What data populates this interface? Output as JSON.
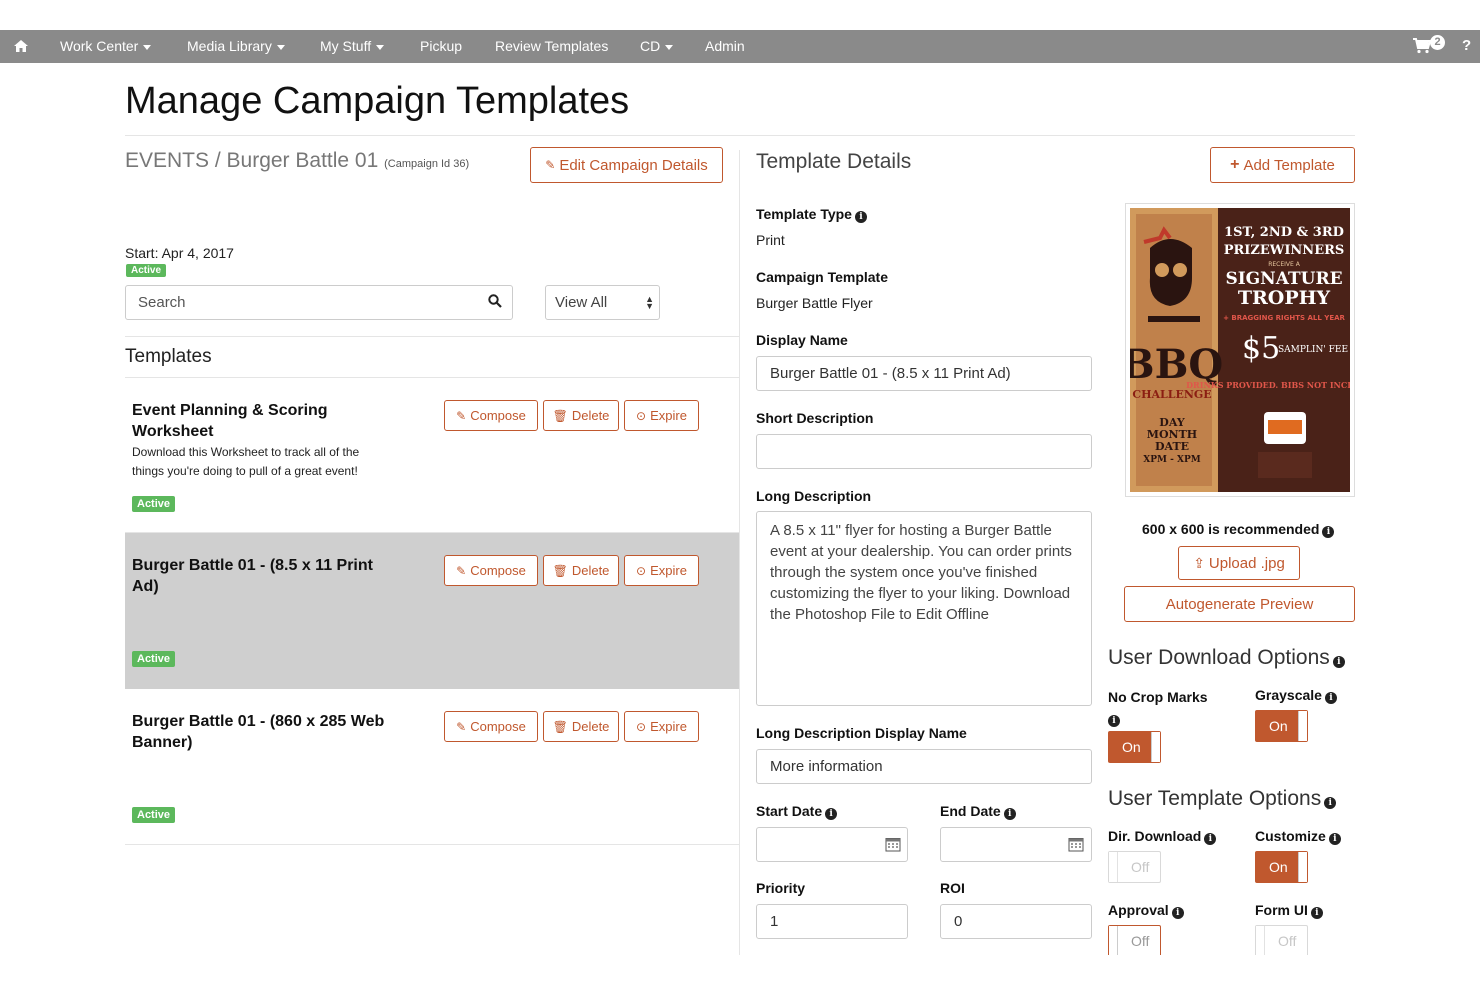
{
  "nav": {
    "items": [
      {
        "label": "Work Center"
      },
      {
        "label": "Media Library"
      },
      {
        "label": "My Stuff"
      },
      {
        "label": "Pickup"
      },
      {
        "label": "Review Templates"
      },
      {
        "label": "CD"
      },
      {
        "label": "Admin"
      }
    ],
    "cart_count": "2",
    "help": "?"
  },
  "page": {
    "title": "Manage Campaign Templates"
  },
  "campaign": {
    "breadcrumb": "EVENTS / Burger Battle 01",
    "id_note": "(Campaign Id 36)",
    "edit_label": "Edit Campaign Details",
    "start": "Start: Apr 4, 2017",
    "status": "Active"
  },
  "search": {
    "placeholder": "Search"
  },
  "filter": {
    "selected": "View All"
  },
  "templates": {
    "heading": "Templates",
    "compose_label": "Compose",
    "delete_label": "Delete",
    "expire_label": "Expire",
    "items": [
      {
        "title": "Event Planning & Scoring Worksheet",
        "desc": "Download this Worksheet to track all of the things you're doing to pull of a great event!",
        "status": "Active"
      },
      {
        "title": "Burger Battle 01 - (8.5 x 11 Print Ad)",
        "desc": "",
        "status": "Active"
      },
      {
        "title": "Burger Battle 01 - (860 x 285 Web Banner)",
        "desc": "",
        "status": "Active"
      }
    ]
  },
  "details": {
    "heading": "Template Details",
    "add_label": "Add Template",
    "type_label": "Template Type",
    "type_value": "Print",
    "campaign_template_label": "Campaign Template",
    "campaign_template_value": "Burger Battle Flyer",
    "display_name_label": "Display Name",
    "display_name_value": "Burger Battle 01 - (8.5 x 11 Print Ad)",
    "short_desc_label": "Short Description",
    "short_desc_value": "",
    "long_desc_label": "Long Description",
    "long_desc_value": "A 8.5 x 11\" flyer for hosting a Burger Battle event at your dealership. You can order prints through the system once you've finished customizing the flyer to your liking. Download the Photoshop File to Edit Offline",
    "long_desc_display_label": "Long Description Display Name",
    "long_desc_display_value": "More information",
    "start_date_label": "Start Date",
    "end_date_label": "End Date",
    "priority_label": "Priority",
    "priority_value": "1",
    "roi_label": "ROI",
    "roi_value": "0"
  },
  "preview": {
    "poster": {
      "line1": "1ST, 2ND & 3RD",
      "line2": "PRIZEWINNERS",
      "line3": "RECEIVE A",
      "line4": "SIGNATURE",
      "line5": "TROPHY",
      "line6": "+ BRAGGING RIGHTS ALL YEAR",
      "price": "$5",
      "price_note": "SAMPLIN' FEE",
      "bbq": "BBQ",
      "challenge": "CHALLENGE",
      "day": "DAY",
      "month": "MONTH",
      "date": "DATE",
      "time": "XPM - XPM",
      "drinks": "DRINKS PROVIDED. BIBS NOT INCLUDED."
    },
    "recommend": "600 x 600 is recommended",
    "upload_label": "Upload .jpg",
    "autogen_label": "Autogenerate Preview"
  },
  "download_options": {
    "heading": "User Download Options",
    "no_crop_label": "No Crop Marks",
    "no_crop_state": "On",
    "grayscale_label": "Grayscale",
    "grayscale_state": "On"
  },
  "template_options": {
    "heading": "User Template Options",
    "dir_download_label": "Dir. Download",
    "dir_download_state": "Off",
    "customize_label": "Customize",
    "customize_state": "On",
    "approval_label": "Approval",
    "approval_state": "Off",
    "form_ui_label": "Form UI",
    "form_ui_state": "Off"
  },
  "colors": {
    "accent": "#c0582e",
    "nav": "#8a8a8a",
    "active": "#5cb85c",
    "highlight": "#cfcfcf"
  }
}
